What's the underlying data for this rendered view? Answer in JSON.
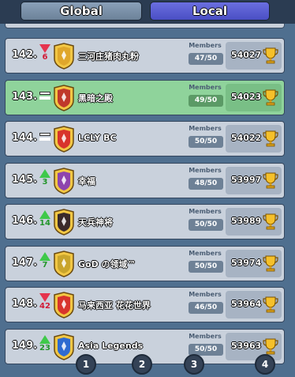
{
  "tabs": {
    "global": "Global",
    "local": "Local"
  },
  "members_label": "Members",
  "rows": [
    {
      "rank": "142.",
      "change_dir": "down",
      "change_num": "6",
      "name": "三河庄猪肉丸粉",
      "members": "47/50",
      "trophies": "54027",
      "badge_color": "#e0a72a",
      "highlight": false
    },
    {
      "rank": "143.",
      "change_dir": "same",
      "change_num": "",
      "name": "黑暗之殿",
      "members": "49/50",
      "trophies": "54023",
      "badge_color": "#c0392b",
      "highlight": true
    },
    {
      "rank": "144.",
      "change_dir": "same",
      "change_num": "",
      "name": "LCLY BC",
      "members": "50/50",
      "trophies": "54022",
      "badge_color": "#d8342c",
      "highlight": false
    },
    {
      "rank": "145.",
      "change_dir": "up",
      "change_num": "3",
      "name": "幸福",
      "members": "48/50",
      "trophies": "53997",
      "badge_color": "#8e44ad",
      "highlight": false
    },
    {
      "rank": "146.",
      "change_dir": "up",
      "change_num": "14",
      "name": "天兵神将",
      "members": "50/50",
      "trophies": "53989",
      "badge_color": "#3a2a2a",
      "highlight": false
    },
    {
      "rank": "147.",
      "change_dir": "up",
      "change_num": "7",
      "name": "GoD の领域™",
      "members": "50/50",
      "trophies": "53974",
      "badge_color": "#c9a52c",
      "highlight": false
    },
    {
      "rank": "148.",
      "change_dir": "down",
      "change_num": "42",
      "name": "马来西亚 花花世界",
      "members": "46/50",
      "trophies": "53964",
      "badge_color": "#d8342c",
      "highlight": false
    },
    {
      "rank": "149.",
      "change_dir": "up",
      "change_num": "23",
      "name": "Asia Legends",
      "members": "50/50",
      "trophies": "53963",
      "badge_color": "#2e6bd0",
      "highlight": false
    }
  ],
  "pager": [
    "1",
    "2",
    "3",
    "4"
  ]
}
